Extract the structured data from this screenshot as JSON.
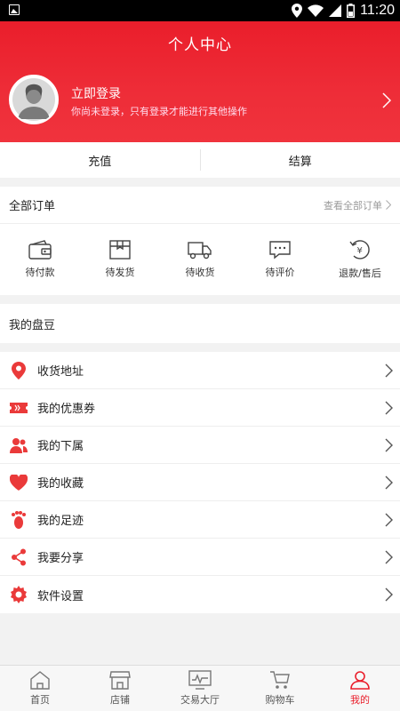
{
  "status_bar": {
    "time": "11:20"
  },
  "header": {
    "title": "个人中心",
    "login_title": "立即登录",
    "login_subtitle": "你尚未登录，只有登录才能进行其他操作"
  },
  "wallet": {
    "recharge": "充值",
    "settle": "结算"
  },
  "orders": {
    "title": "全部订单",
    "view_all": "查看全部订单",
    "items": [
      {
        "label": "待付款",
        "icon": "wallet-icon"
      },
      {
        "label": "待发货",
        "icon": "box-icon"
      },
      {
        "label": "待收货",
        "icon": "truck-icon"
      },
      {
        "label": "待评价",
        "icon": "comment-icon"
      },
      {
        "label": "退款/售后",
        "icon": "refund-icon"
      }
    ]
  },
  "beans": {
    "title": "我的盘豆"
  },
  "menu": {
    "items": [
      {
        "label": "收货地址",
        "icon": "location-pin-icon"
      },
      {
        "label": "我的优惠券",
        "icon": "ticket-icon"
      },
      {
        "label": "我的下属",
        "icon": "users-icon"
      },
      {
        "label": "我的收藏",
        "icon": "heart-icon"
      },
      {
        "label": "我的足迹",
        "icon": "footprint-icon"
      },
      {
        "label": "我要分享",
        "icon": "share-icon"
      },
      {
        "label": "软件设置",
        "icon": "settings-gear-icon"
      }
    ]
  },
  "tabs": [
    {
      "label": "首页",
      "icon": "home-icon",
      "active": false
    },
    {
      "label": "店铺",
      "icon": "store-icon",
      "active": false
    },
    {
      "label": "交易大厅",
      "icon": "trade-hall-icon",
      "active": false
    },
    {
      "label": "购物车",
      "icon": "cart-icon",
      "active": false
    },
    {
      "label": "我的",
      "icon": "person-icon",
      "active": true
    }
  ],
  "colors": {
    "accent": "#ea1e2b",
    "background": "#f2f2f2"
  }
}
